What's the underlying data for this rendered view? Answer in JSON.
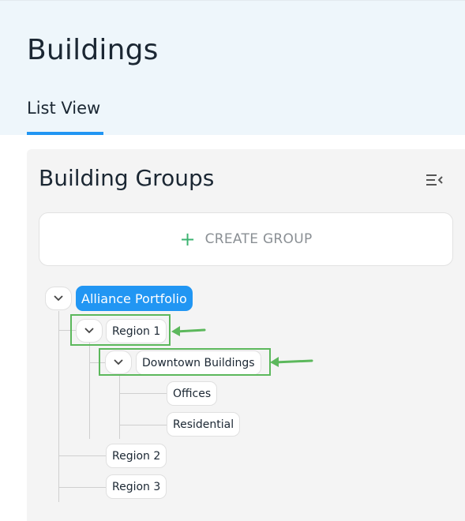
{
  "header": {
    "title": "Buildings",
    "tabs": [
      {
        "label": "List View",
        "active": true
      }
    ]
  },
  "panel": {
    "title": "Building Groups",
    "collapse_icon": "menu-collapse-icon",
    "create_button": {
      "icon": "plus-icon",
      "label": "CREATE GROUP"
    }
  },
  "tree": {
    "root": {
      "label": "Alliance Portfolio",
      "selected": true,
      "expanded": true
    },
    "region1": {
      "label": "Region 1",
      "expanded": true
    },
    "downtown": {
      "label": "Downtown Buildings",
      "expanded": true
    },
    "offices": {
      "label": "Offices"
    },
    "residential": {
      "label": "Residential"
    },
    "region2": {
      "label": "Region 2"
    },
    "region3": {
      "label": "Region 3"
    }
  },
  "colors": {
    "accent": "#2196f3",
    "highlight_annotation": "#5cb85c",
    "plus": "#3cb371"
  }
}
